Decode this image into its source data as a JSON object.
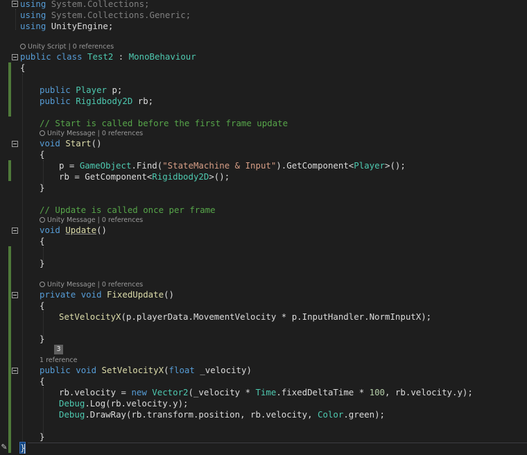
{
  "code": {
    "using1": {
      "kw": "using",
      "ns": "System.Collections;"
    },
    "using2": {
      "kw": "using",
      "ns": "System.Collections.Generic;"
    },
    "using3": {
      "kw": "using",
      "ns": "UnityEngine;"
    },
    "class_decl": {
      "kw1": "public",
      "kw2": "class",
      "name": "Test2",
      "sep": " : ",
      "base": "MonoBehaviour"
    },
    "open_brace": "{",
    "close_brace": "}",
    "field1": {
      "kw": "public",
      "type": "Player",
      "rest": " p;"
    },
    "field2": {
      "kw": "public",
      "type": "Rigidbody2D",
      "rest": " rb;"
    },
    "comment_start": "// Start is called before the first frame update",
    "start_decl": {
      "kw": "void",
      "name": "Start",
      "rest": "()"
    },
    "start_l1": {
      "a": "p = ",
      "b": "GameObject",
      "c": ".Find(",
      "d": "\"StateMachine & Input\"",
      "e": ").GetComponent<",
      "f": "Player",
      "g": ">();"
    },
    "start_l2": {
      "a": "rb = GetComponent<",
      "b": "Rigidbody2D",
      "c": ">();"
    },
    "comment_update": "// Update is called once per frame",
    "update_decl": {
      "kw": "void",
      "name": "Update",
      "rest": "()"
    },
    "fixed_decl": {
      "kw1": "private",
      "kw2": "void",
      "name": "FixedUpdate",
      "rest": "()"
    },
    "fixed_l1": {
      "a": "SetVelocityX",
      "b": "(p.playerData.MovementVelocity * p.InputHandler.NormInputX);"
    },
    "svx_decl": {
      "kw1": "public",
      "kw2": "void",
      "name": "SetVelocityX",
      "a": "(",
      "kw3": "float",
      "b": " _velocity)"
    },
    "svx_l1": {
      "a": "rb.velocity = ",
      "kw": "new",
      "type": "Vector2",
      "b": "(_velocity * ",
      "t2": "Time",
      "c": ".fixedDeltaTime * ",
      "num": "100",
      "d": ", rb.velocity.y);"
    },
    "svx_l2": {
      "type": "Debug",
      "a": ".Log(rb.velocity.y);"
    },
    "svx_l3": {
      "type": "Debug",
      "a": ".DrawRay(rb.transform.position, rb.velocity, ",
      "t2": "Color",
      "b": ".green);"
    }
  },
  "codelens": {
    "class": {
      "a": "Unity Script",
      "b": "0 references"
    },
    "start": {
      "a": "Unity Message",
      "b": "0 references"
    },
    "update": {
      "a": "Unity Message",
      "b": "0 references"
    },
    "fixed": {
      "a": "Unity Message",
      "b": "0 references"
    },
    "svx": {
      "a": "1 reference"
    },
    "sep": " | "
  },
  "badge": {
    "value": "3"
  },
  "colors": {
    "background": "#1e1e1e",
    "keyword": "#569cd6",
    "type": "#4ec9b0",
    "string": "#d69d85",
    "comment": "#57a64a",
    "method": "#dcdcaa",
    "number": "#b5cea8",
    "gutter_change": "#4f7a3a"
  },
  "icons": [
    "codelens-icon",
    "fold-toggle-icon",
    "pin-icon"
  ]
}
